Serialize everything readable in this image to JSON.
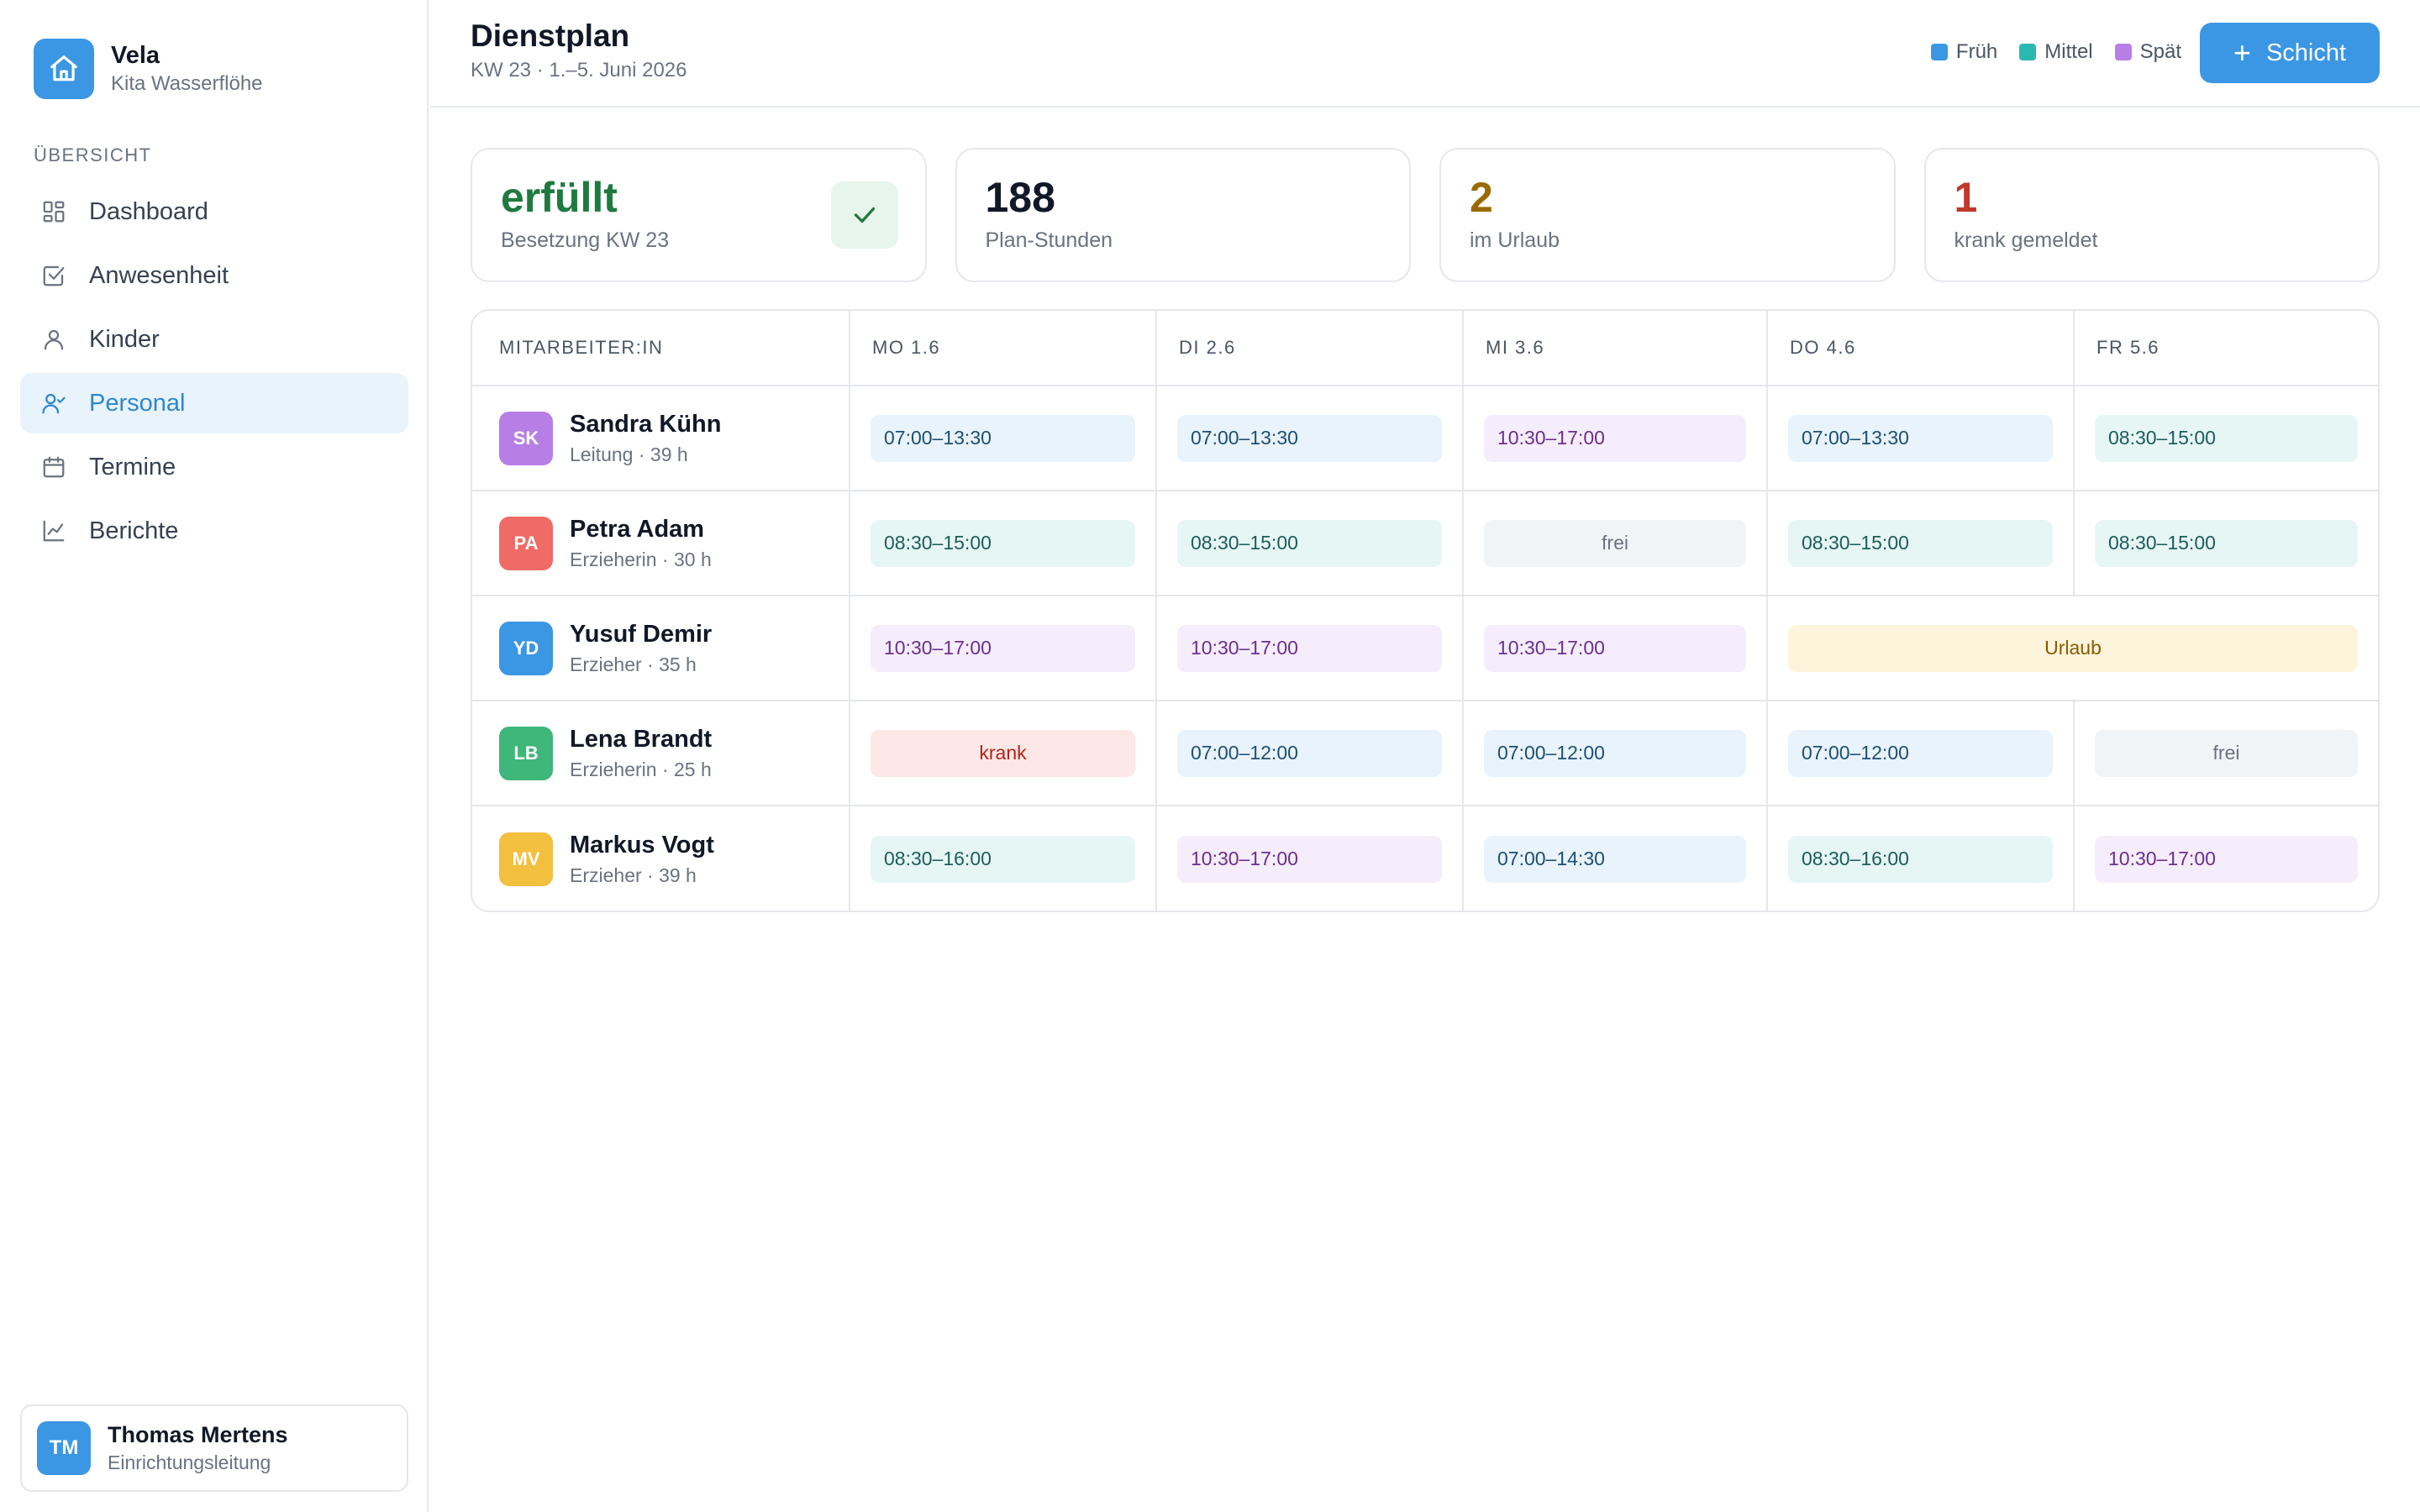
{
  "brand": {
    "name": "Vela",
    "subtitle": "Kita Wasserflöhe"
  },
  "sidebar": {
    "section_label": "ÜBERSICHT",
    "items": [
      {
        "label": "Dashboard",
        "icon": "grid-icon"
      },
      {
        "label": "Anwesenheit",
        "icon": "checkbox-icon"
      },
      {
        "label": "Kinder",
        "icon": "person-icon"
      },
      {
        "label": "Personal",
        "icon": "staff-icon",
        "active": true
      },
      {
        "label": "Termine",
        "icon": "calendar-icon"
      },
      {
        "label": "Berichte",
        "icon": "chart-line-icon"
      }
    ],
    "user": {
      "initials": "TM",
      "name": "Thomas Mertens",
      "role": "Einrichtungsleitung"
    }
  },
  "header": {
    "title": "Dienstplan",
    "subtitle": "KW 23 · 1.–5. Juni 2026",
    "legend": [
      {
        "label": "Früh",
        "color": "#3b96e4"
      },
      {
        "label": "Mittel",
        "color": "#2bb8b0"
      },
      {
        "label": "Spät",
        "color": "#b77ee6"
      }
    ],
    "add_button": "Schicht"
  },
  "kpis": [
    {
      "value": "erfüllt",
      "label": "Besetzung KW 23",
      "color": "#1f7a3f"
    },
    {
      "value": "188",
      "label": "Plan-Stunden",
      "color": "#111827"
    },
    {
      "value": "2",
      "label": "im Urlaub",
      "color": "#9a6a00"
    },
    {
      "value": "1",
      "label": "krank gemeldet",
      "color": "#c0392b"
    }
  ],
  "schedule": {
    "headers": [
      "MITARBEITER:IN",
      "MO 1.6",
      "DI 2.6",
      "MI 3.6",
      "DO 4.6",
      "FR 5.6"
    ],
    "rows": [
      {
        "initials": "SK",
        "name": "Sandra Kühn",
        "meta": "Leitung · 39 h",
        "avatar_color": "#b77ee6",
        "shifts": [
          "07:00–13:30",
          "07:00–13:30",
          "10:30–17:00",
          "07:00–13:30",
          "08:30–15:00"
        ]
      },
      {
        "initials": "PA",
        "name": "Petra Adam",
        "meta": "Erzieherin · 30 h",
        "avatar_color": "#ef6b66",
        "shifts": [
          "08:30–15:00",
          "08:30–15:00",
          "frei",
          "08:30–15:00",
          "08:30–15:00"
        ]
      },
      {
        "initials": "YD",
        "name": "Yusuf Demir",
        "meta": "Erzieher · 35 h",
        "avatar_color": "#3b96e4",
        "shifts": [
          "10:30–17:00",
          "10:30–17:00",
          "10:30–17:00",
          "Urlaub"
        ]
      },
      {
        "initials": "LB",
        "name": "Lena Brandt",
        "meta": "Erzieherin · 25 h",
        "avatar_color": "#3fb67a",
        "shifts": [
          "krank",
          "07:00–12:00",
          "07:00–12:00",
          "07:00–12:00",
          "frei"
        ]
      },
      {
        "initials": "MV",
        "name": "Markus Vogt",
        "meta": "Erzieher · 39 h",
        "avatar_color": "#f2bf3f",
        "shifts": [
          "08:30–16:00",
          "10:30–17:00",
          "07:00–14:30",
          "08:30–16:00",
          "10:30–17:00"
        ]
      }
    ]
  }
}
